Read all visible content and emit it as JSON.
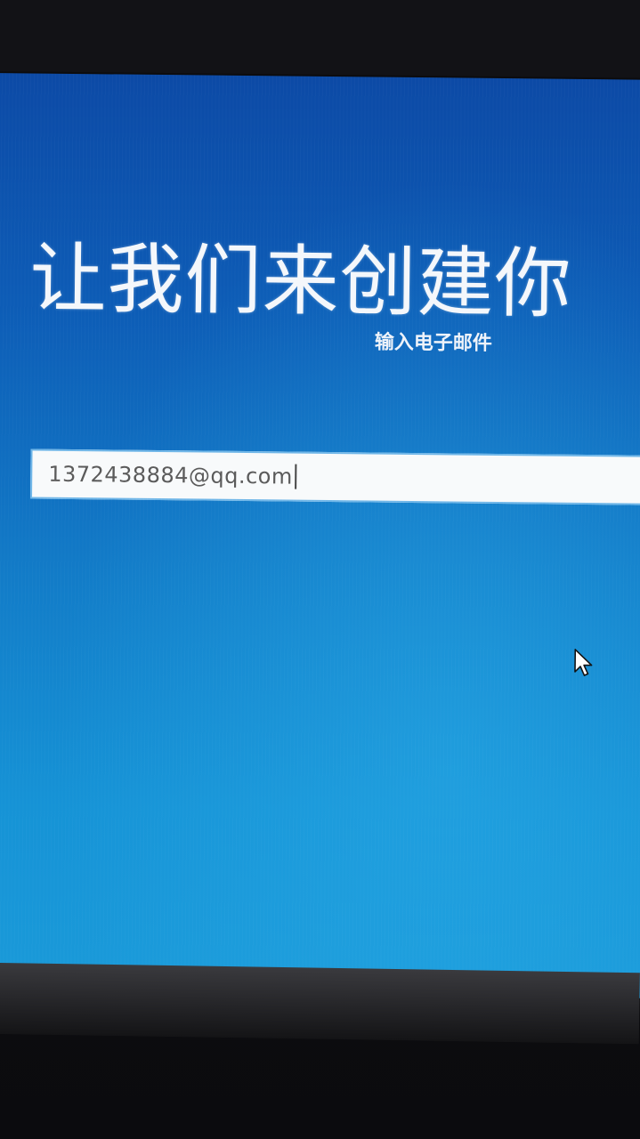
{
  "setup": {
    "title": "让我们来创建你",
    "subtitle": "输入电子邮件",
    "email": {
      "value": "1372438884@qq.com"
    }
  },
  "icons": {
    "pointer": "mouse-pointer-icon"
  },
  "colors": {
    "screen_top": "#0c4aa6",
    "screen_bottom": "#1a9ad9",
    "input_background": "#f8fafb",
    "input_border": "#6fb6e8",
    "text": "#f4f7fb"
  }
}
